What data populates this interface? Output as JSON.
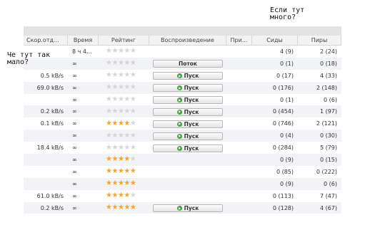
{
  "notes": {
    "top_line1": "Если тут",
    "top_line2": "много?",
    "left_line1": "Че тут так",
    "left_line2": "мало?"
  },
  "columns": {
    "speed": "Скор.отд...",
    "time": "Время",
    "rating": "Рейтинг",
    "play": "Воспроизведение",
    "priority": "При...",
    "seeds": "Сиды",
    "peers": "Пиры"
  },
  "colors": {
    "star_on": "#f5a623",
    "star_off": "#d6d6d6",
    "play_icon": "#3fa33f"
  },
  "rows": [
    {
      "speed": "",
      "time": "8 ч 4...",
      "rating": 0,
      "play": "",
      "seeds": "4 (9)",
      "peers": "2 (24)"
    },
    {
      "speed": "",
      "time": "∞",
      "rating": 0,
      "play": "Поток",
      "seeds": "0 (1)",
      "peers": "0 (18)"
    },
    {
      "speed": "0.5 kB/s",
      "time": "∞",
      "rating": 0,
      "play": "Пуск",
      "seeds": "0 (17)",
      "peers": "4 (33)"
    },
    {
      "speed": "69.0 kB/s",
      "time": "∞",
      "rating": 0,
      "play": "Пуск",
      "seeds": "0 (176)",
      "peers": "2 (148)"
    },
    {
      "speed": "",
      "time": "∞",
      "rating": 0,
      "play": "Пуск",
      "seeds": "0 (1)",
      "peers": "0 (6)"
    },
    {
      "speed": "0.2 kB/s",
      "time": "∞",
      "rating": 0,
      "play": "Пуск",
      "seeds": "0 (454)",
      "peers": "1 (97)"
    },
    {
      "speed": "0.1 kB/s",
      "time": "∞",
      "rating": 4,
      "play": "Пуск",
      "seeds": "0 (746)",
      "peers": "2 (121)"
    },
    {
      "speed": "",
      "time": "∞",
      "rating": 0,
      "play": "Пуск",
      "seeds": "0 (4)",
      "peers": "0 (30)"
    },
    {
      "speed": "18.4 kB/s",
      "time": "∞",
      "rating": 0,
      "play": "Пуск",
      "seeds": "0 (284)",
      "peers": "5 (79)"
    },
    {
      "speed": "",
      "time": "∞",
      "rating": 4,
      "play": "",
      "seeds": "0 (9)",
      "peers": "0 (15)"
    },
    {
      "speed": "",
      "time": "∞",
      "rating": 5,
      "play": "",
      "seeds": "0 (85)",
      "peers": "0 (222)"
    },
    {
      "speed": "",
      "time": "∞",
      "rating": 5,
      "play": "",
      "seeds": "0 (9)",
      "peers": "0 (6)"
    },
    {
      "speed": "61.0 kB/s",
      "time": "∞",
      "rating": 4,
      "play": "",
      "seeds": "0 (113)",
      "peers": "7 (47)"
    },
    {
      "speed": "0.2 kB/s",
      "time": "∞",
      "rating": 5,
      "play": "Пуск",
      "seeds": "0 (128)",
      "peers": "4 (67)"
    }
  ]
}
